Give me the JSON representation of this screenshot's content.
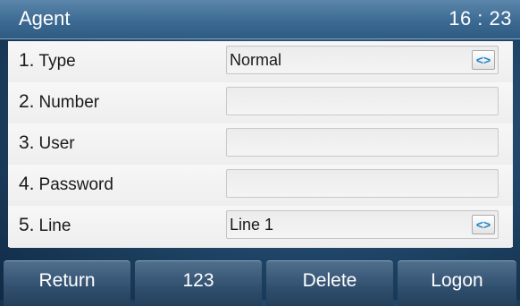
{
  "title": "Agent",
  "clock": "16 : 23",
  "fields": [
    {
      "number": "1.",
      "label": "Type",
      "value": "Normal",
      "control": "select"
    },
    {
      "number": "2.",
      "label": "Number",
      "value": "",
      "control": "input"
    },
    {
      "number": "3.",
      "label": "User",
      "value": "",
      "control": "input"
    },
    {
      "number": "4.",
      "label": "Password",
      "value": "",
      "control": "input"
    },
    {
      "number": "5.",
      "label": "Line",
      "value": "Line 1",
      "control": "select"
    }
  ],
  "switch_icon_glyph": "<>",
  "softkeys": [
    "Return",
    "123",
    "Delete",
    "Logon"
  ],
  "colors": {
    "title_bar": "#3c6a92",
    "softkey": "#304f6e",
    "switch_icon": "#1e83c8"
  }
}
